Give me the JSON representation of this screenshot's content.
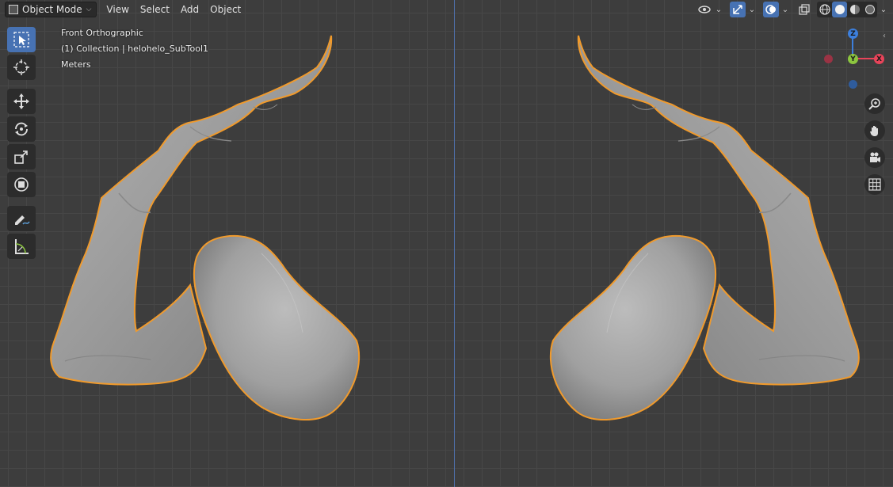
{
  "header": {
    "mode_label": "Object Mode",
    "menu": [
      "View",
      "Select",
      "Add",
      "Object"
    ]
  },
  "overlay": {
    "view_name": "Front Orthographic",
    "collection": "(1) Collection | helohelo_SubTool1",
    "units": "Meters"
  },
  "gizmo": {
    "z_label": "Z",
    "y_label": "Y",
    "x_label": "X",
    "colors": {
      "x": "#e8445a",
      "y": "#8cc63f",
      "z": "#3c7fdc"
    }
  },
  "icons": {
    "toolbar": [
      "select-box-icon",
      "cursor-icon",
      "move-icon",
      "rotate-icon",
      "scale-icon",
      "transform-icon",
      "annotate-icon",
      "measure-icon"
    ],
    "navigation": [
      "zoom-icon",
      "hand-pan-icon",
      "camera-icon",
      "grid-icon"
    ]
  },
  "colors": {
    "background": "#3d3d3d",
    "grid": "#474747",
    "selection_outline": "#f09a2c",
    "mesh": "#a3a3a3",
    "accent": "#4772b3"
  }
}
